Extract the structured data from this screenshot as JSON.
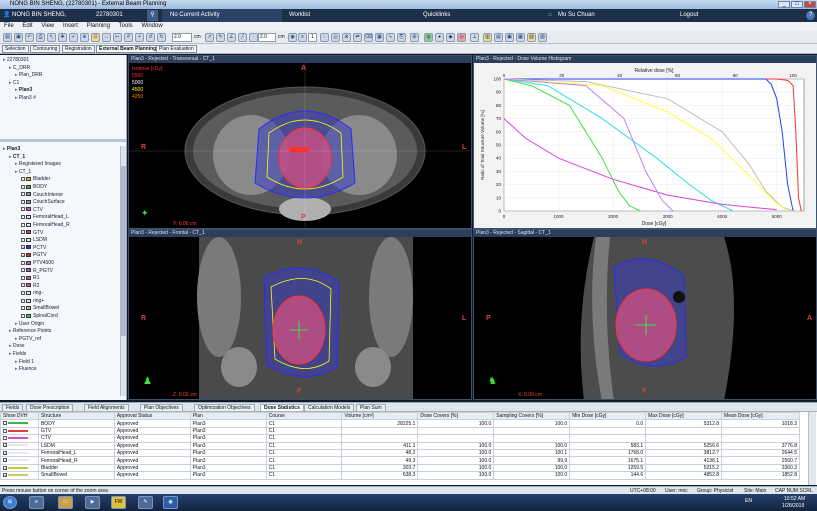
{
  "window_title": "NONG BIN SHENG,  (22780301) - External Beam Planning",
  "topbar": {
    "patient": "NONG BIN SHENG,",
    "patient_id": "22780301",
    "activity": "No Current Activity",
    "worklist": "Worklist",
    "quicklinks": "Quicklinks",
    "user": "Mo Su Chuan",
    "logout": "Logout"
  },
  "menu": [
    "File",
    "Edit",
    "View",
    "Insert",
    "Planning",
    "Tools",
    "Window"
  ],
  "toolbar": {
    "zoom1": "2.0",
    "unit1": "cm",
    "zoom2": "2.0",
    "unit2": "cm",
    "page": "1"
  },
  "workflow": [
    "Selection",
    "Contouring",
    "Registration",
    "External Beam Planning",
    "Plan Evaluation"
  ],
  "course_tree": [
    {
      "label": "22780301",
      "indent": 0
    },
    {
      "label": "C_DRR",
      "indent": 1
    },
    {
      "label": "Plan_DRR",
      "indent": 2
    },
    {
      "label": "C1",
      "indent": 1
    },
    {
      "label": "Plan3",
      "indent": 2,
      "bold": true
    },
    {
      "label": "Plan3 #",
      "indent": 2
    }
  ],
  "structure_tree": [
    {
      "label": "Plan3",
      "indent": 0,
      "bold": true
    },
    {
      "label": "CT_1",
      "indent": 1,
      "bold": true
    },
    {
      "label": "Registered Images",
      "indent": 2
    },
    {
      "label": "CT_1",
      "indent": 2
    },
    {
      "label": "Bladder",
      "indent": 3,
      "color": "#c8c832",
      "checked": false
    },
    {
      "label": "BODY",
      "indent": 3,
      "color": "#3cb43c",
      "checked": false
    },
    {
      "label": "CouchInterior",
      "indent": 3,
      "color": "#7da3c8",
      "checked": false
    },
    {
      "label": "CouchSurface",
      "indent": 3,
      "color": "#7da3c8",
      "checked": false
    },
    {
      "label": "CTV",
      "indent": 3,
      "color": "#d24bd2",
      "checked": false
    },
    {
      "label": "FemoralHead_L",
      "indent": 3,
      "color": "#e6e6ff",
      "checked": false
    },
    {
      "label": "FemoralHead_R",
      "indent": 3,
      "color": "#e6e6ff",
      "checked": false
    },
    {
      "label": "GTV",
      "indent": 3,
      "color": "#e63c3c",
      "checked": false
    },
    {
      "label": "LSDM",
      "indent": 3,
      "color": "#e6e6e6",
      "checked": false
    },
    {
      "label": "PCTV",
      "indent": 3,
      "color": "#2828e6",
      "checked": true
    },
    {
      "label": "PGTV",
      "indent": 3,
      "color": "#e62828",
      "checked": true
    },
    {
      "label": "PTV4500",
      "indent": 3,
      "color": "#d250d2",
      "checked": false
    },
    {
      "label": "R_PGTV",
      "indent": 3,
      "color": "#8c64c8",
      "checked": false
    },
    {
      "label": "R1",
      "indent": 3,
      "color": "#e650a0",
      "checked": false
    },
    {
      "label": "R2",
      "indent": 3,
      "color": "#e650a0",
      "checked": false
    },
    {
      "label": "ring-",
      "indent": 3,
      "color": "#eeeeee",
      "checked": false
    },
    {
      "label": "ring+",
      "indent": 3,
      "color": "#eeeeee",
      "checked": false
    },
    {
      "label": "SmallBowel",
      "indent": 3,
      "color": "#c8c864",
      "checked": false
    },
    {
      "label": "SpinalCord",
      "indent": 3,
      "color": "#50c850",
      "checked": false
    },
    {
      "label": "User Origin",
      "indent": 2
    },
    {
      "label": "Reference Points",
      "indent": 1
    },
    {
      "label": "PGTV_ref",
      "indent": 2
    },
    {
      "label": "Dose",
      "indent": 1
    },
    {
      "label": "Fields",
      "indent": 1
    },
    {
      "label": "Field 1",
      "indent": 2
    },
    {
      "label": "Fluence",
      "indent": 2
    }
  ],
  "viewers": {
    "transversal_title": "Plan3 - Rejected - Transversal - CT_1",
    "dvh_title": "Plan3 - Rejected - Dose Volume Histogram",
    "frontal_title": "Plan3 - Rejected - Frontal - CT_1",
    "sagittal_title": "Plan3 - Rejected - Sagittal - CT_1",
    "isodose_header": "Isodose [cGy]",
    "isodose_levels": [
      "5500",
      "5000",
      "4500",
      "4250"
    ],
    "isodose_colors": [
      "#ff3030",
      "#ffffff",
      "#ffff00",
      "#ff8000"
    ],
    "transversal_coord": "Y: 0.00 cm",
    "frontal_coord": "Z: 0.00 cm",
    "sagittal_coord": "X: 0.00 cm",
    "orient": {
      "A": "A",
      "P": "P",
      "R": "R",
      "L": "L",
      "H": "H",
      "F": "F"
    }
  },
  "chart_data": {
    "type": "line",
    "title": "",
    "xlabel": "Dose [cGy]",
    "ylabel": "Ratio of Total Structure Volume [%]",
    "x2label": "Relative dose [%]",
    "xlim": [
      0,
      5500
    ],
    "ylim": [
      0,
      100
    ],
    "x_ticks": [
      0,
      1000,
      2000,
      3000,
      4000,
      5000
    ],
    "y_ticks": [
      0,
      10,
      20,
      30,
      40,
      50,
      60,
      70,
      80,
      90,
      100
    ],
    "x2_ticks": [
      0,
      20,
      40,
      60,
      80,
      100
    ],
    "series": [
      {
        "color": "#ff3030",
        "x": [
          0,
          5000,
          5200,
          5300,
          5350,
          5400,
          5450
        ],
        "y": [
          100,
          100,
          99,
          95,
          60,
          10,
          0
        ]
      },
      {
        "color": "#2040ff",
        "x": [
          0,
          4800,
          4900,
          5000,
          5100,
          5200,
          5300
        ],
        "y": [
          100,
          100,
          96,
          85,
          60,
          20,
          0
        ]
      },
      {
        "color": "#ffffff",
        "x": [
          0,
          1500,
          3000,
          4000,
          4500,
          4800,
          5100,
          5300
        ],
        "y": [
          100,
          98,
          85,
          60,
          35,
          15,
          3,
          0
        ]
      },
      {
        "color": "#ffff40",
        "x": [
          0,
          1800,
          3000,
          3800,
          4300,
          4700,
          5000,
          5200
        ],
        "y": [
          100,
          95,
          75,
          55,
          35,
          18,
          6,
          0
        ]
      },
      {
        "color": "#30e0e0",
        "x": [
          0,
          800,
          1800,
          2800,
          3400,
          3800,
          4200
        ],
        "y": [
          100,
          95,
          70,
          40,
          20,
          8,
          0
        ]
      },
      {
        "color": "#40e040",
        "x": [
          0,
          500,
          1200,
          1800,
          2100,
          2300,
          2500
        ],
        "y": [
          100,
          95,
          80,
          40,
          15,
          4,
          0
        ]
      },
      {
        "color": "#e040e0",
        "x": [
          0,
          400,
          1000,
          2000,
          3000,
          4000,
          5000
        ],
        "y": [
          70,
          55,
          40,
          24,
          12,
          5,
          1
        ]
      },
      {
        "color": "#c080ff",
        "x": [
          0,
          1500,
          2200,
          2600,
          2900,
          3100
        ],
        "y": [
          100,
          95,
          70,
          30,
          8,
          0
        ]
      }
    ]
  },
  "tabs": [
    "Fields",
    "Dose Prescription",
    "Field Alignments",
    "Plan Objectives",
    "Optimization Objectives",
    "Dose Statistics",
    "Calculation Models",
    "Plan Sum"
  ],
  "active_tab": "Dose Statistics",
  "table": {
    "headers": [
      "Show DVH",
      "Structure",
      "Approval Status",
      "Plan",
      "Course",
      "Volume [cm³]",
      "Dose Covers [%]",
      "Sampling Covers [%]",
      "Min Dose [cGy]",
      "Max Dose [cGy]",
      "Mean Dose [cGy]"
    ],
    "rows": [
      {
        "show": false,
        "color": "#3cb43c",
        "structure": "BODY",
        "status": "Approved",
        "plan": "Plan3",
        "course": "C1",
        "volume": "28225.1",
        "dose_cov": "100.0",
        "samp_cov": "100.0",
        "min": "0.0",
        "max": "5312.8",
        "mean": "1018.3"
      },
      {
        "show": false,
        "color": "#e63c3c",
        "structure": "GTV",
        "status": "Approved",
        "plan": "Plan3",
        "course": "C1",
        "volume": "",
        "dose_cov": "",
        "samp_cov": "",
        "min": "",
        "max": "",
        "mean": ""
      },
      {
        "show": false,
        "color": "#d24bd2",
        "structure": "CTV",
        "status": "Approved",
        "plan": "Plan3",
        "course": "C1",
        "volume": "",
        "dose_cov": "",
        "samp_cov": "",
        "min": "",
        "max": "",
        "mean": ""
      },
      {
        "show": true,
        "color": "#e6e6e6",
        "structure": "LSDM",
        "status": "Approved",
        "plan": "Plan3",
        "course": "C1",
        "volume": "411.1",
        "dose_cov": "100.0",
        "samp_cov": "100.0",
        "min": "583.1",
        "max": "5256.6",
        "mean": "3776.8"
      },
      {
        "show": true,
        "color": "#e6e6ff",
        "structure": "FemoralHead_L",
        "status": "Approved",
        "plan": "Plan3",
        "course": "C1",
        "volume": "48.2",
        "dose_cov": "100.0",
        "samp_cov": "100.1",
        "min": "1768.0",
        "max": "3812.7",
        "mean": "2644.5"
      },
      {
        "show": true,
        "color": "#e6e6ff",
        "structure": "FemoralHead_R",
        "status": "Approved",
        "plan": "Plan3",
        "course": "C1",
        "volume": "49.3",
        "dose_cov": "100.0",
        "samp_cov": "99.9",
        "min": "1675.1",
        "max": "4138.1",
        "mean": "2560.7"
      },
      {
        "show": true,
        "color": "#c8c832",
        "structure": "Bladder",
        "status": "Approved",
        "plan": "Plan3",
        "course": "C1",
        "volume": "303.7",
        "dose_cov": "100.0",
        "samp_cov": "100.0",
        "min": "1259.5",
        "max": "5215.2",
        "mean": "3360.3"
      },
      {
        "show": true,
        "color": "#c8c864",
        "structure": "SmallBowel",
        "status": "Approved",
        "plan": "Plan3",
        "course": "C1",
        "volume": "638.3",
        "dose_cov": "100.0",
        "samp_cov": "100.0",
        "min": "144.6",
        "max": "4852.8",
        "mean": "1852.8"
      }
    ]
  },
  "status": {
    "message": "Press mouse button on corner of the zoom area",
    "tz": "UTC+08:00",
    "user": "User: moc",
    "group": "Group: Physicist",
    "site": "Site: Main",
    "keys": "CAP  NUM  SCRL"
  },
  "taskbar": {
    "lang": "EN",
    "time": "10:52 AM",
    "date": "1/28/2019"
  }
}
